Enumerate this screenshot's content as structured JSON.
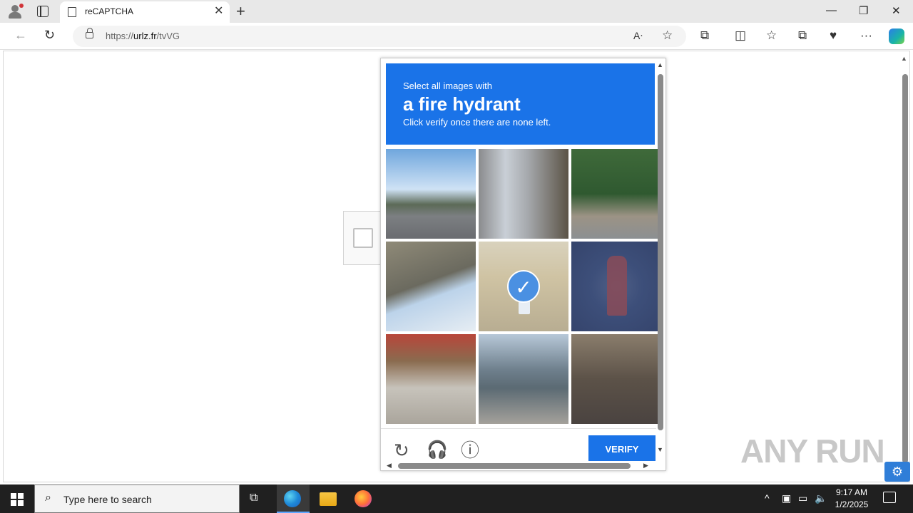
{
  "browser": {
    "tab_title": "reCAPTCHA",
    "tab_close": "✕",
    "new_tab": "+",
    "url_prefix": "https://",
    "url_host": "urlz.fr",
    "url_path": "/tvVG",
    "window_controls": {
      "minimize": "—",
      "restore": "❐",
      "close": "✕"
    },
    "nav": {
      "back": "←",
      "reload": "↻"
    },
    "toolbar_icons": {
      "read_aloud": "Aᐧ",
      "favorite": "☆",
      "extensions": "⧉",
      "split": "◫",
      "favorites": "☆",
      "collections": "⧉",
      "performance": "♥",
      "more": "···"
    }
  },
  "captcha": {
    "prompt_line1": "Select all images with",
    "prompt_target": "a fire hydrant",
    "prompt_line3": "Click verify once there are none left.",
    "verify_label": "VERIFY",
    "reload_glyph": "↻",
    "audio_glyph": "🎧",
    "info_glyph": "ⓘ",
    "tiles": [
      {
        "content": "street with cars",
        "selected": false
      },
      {
        "content": "building with bicycles",
        "selected": false
      },
      {
        "content": "trees and traffic light",
        "selected": false
      },
      {
        "content": "overpass",
        "selected": false
      },
      {
        "content": "fire hydrant",
        "selected": true
      },
      {
        "content": "fire hydrant",
        "selected": false
      },
      {
        "content": "motorcycles",
        "selected": false
      },
      {
        "content": "harbor truck",
        "selected": false
      },
      {
        "content": "street motorcycles",
        "selected": false
      }
    ],
    "selected_glyph": "✓"
  },
  "watermark": "ANY RUN",
  "settings_glyph": "⚙",
  "taskbar": {
    "search_placeholder": "Type here to search",
    "search_glyph": "⌕",
    "task_view_glyph": "⧉",
    "tray_chevron": "^",
    "time": "9:17 AM",
    "date": "1/2/2025"
  },
  "colors": {
    "accent": "#1a73e8",
    "taskbar": "#202020"
  }
}
